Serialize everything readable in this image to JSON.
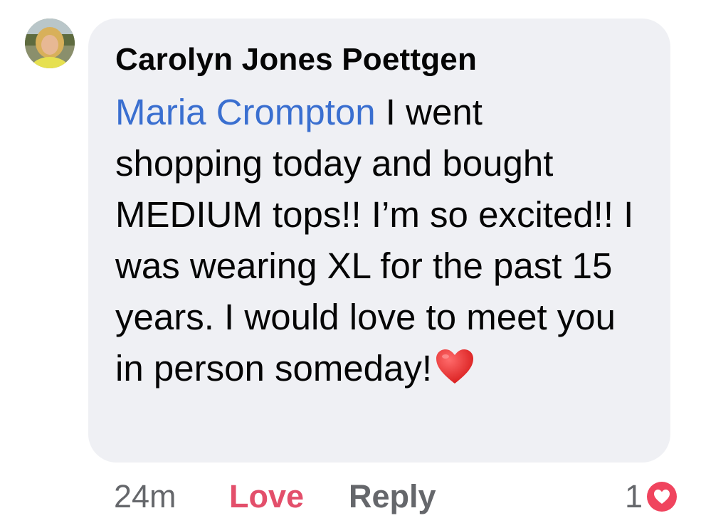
{
  "comment": {
    "author": "Carolyn Jones Poettgen",
    "mention": "Maria Crompton",
    "text": " I went shopping today and bought MEDIUM tops!! I’m so excited!! I was wearing XL for the past 15 years. I would love to meet you in person someday!",
    "emoji": "red-heart-emoji",
    "colors": {
      "bubble": "#eff0f4",
      "mention": "#3a6fd0",
      "love": "#e34f6b",
      "meta": "#65676b"
    }
  },
  "actions": {
    "time": "24m",
    "love": "Love",
    "reply": "Reply"
  },
  "reactions": {
    "count": "1",
    "icon": "love-reaction-icon"
  }
}
